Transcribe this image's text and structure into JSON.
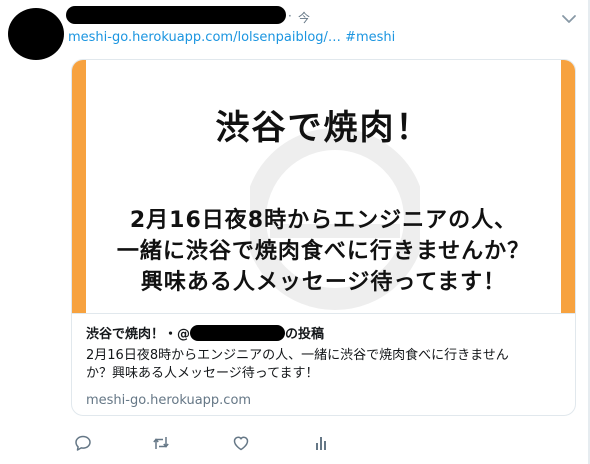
{
  "tweet": {
    "time_separator": "·",
    "time": "今",
    "link_text": "meshi-go.herokuapp.com/lolsenpaiblog/…",
    "hashtag": "#meshi"
  },
  "card": {
    "image": {
      "title": "渋谷で焼肉！",
      "line1": "2月16日夜8時からエンジニアの人、",
      "line2": "一緒に渋谷で焼肉食べに行きませんか？",
      "line3": "興味ある人メッセージ待ってます！"
    },
    "title_prefix": "渋谷で焼肉！・@",
    "title_suffix": "の投稿",
    "description_line1": "2月16日夜8時からエンジニアの人、一緒に渋谷で焼肉食べに行きません",
    "description_line2": "か？興味ある人メッセージ待ってます！",
    "domain": "meshi-go.herokuapp.com"
  },
  "actions": [
    {
      "icon": "reply-icon"
    },
    {
      "icon": "retweet-icon"
    },
    {
      "icon": "like-icon"
    },
    {
      "icon": "analytics-icon"
    }
  ],
  "colors": {
    "link": "#1b95e0",
    "secondary_text": "#657786",
    "card_accent": "#f7a23f",
    "border": "#e1e8ed"
  }
}
